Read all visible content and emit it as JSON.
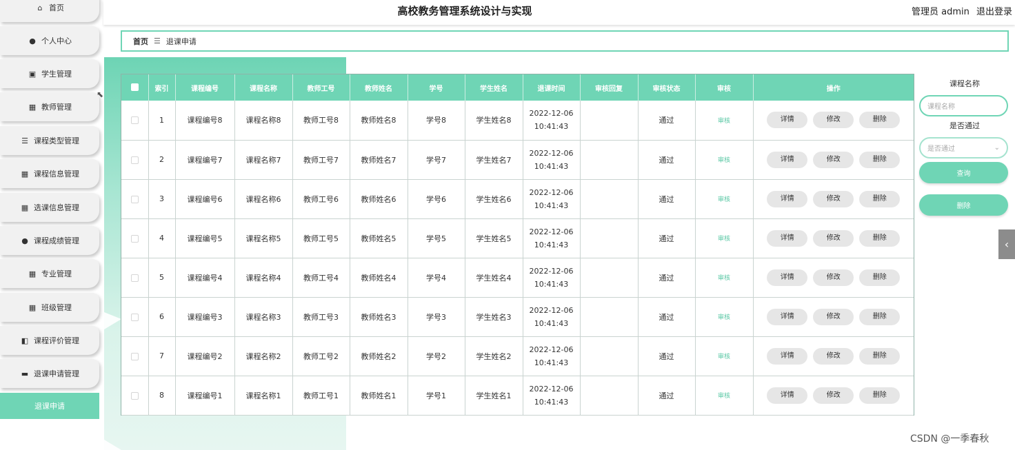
{
  "header": {
    "title": "高校教务管理系统设计与实现",
    "user": "管理员 admin",
    "logout": "退出登录"
  },
  "sidebar": {
    "items": [
      {
        "label": "首页",
        "icon": "home-icon",
        "glyph": "⌂"
      },
      {
        "label": "个人中心",
        "icon": "user-icon",
        "glyph": "●"
      },
      {
        "label": "学生管理",
        "icon": "clipboard-icon",
        "glyph": "▣"
      },
      {
        "label": "教师管理",
        "icon": "grid-icon",
        "glyph": "▦"
      },
      {
        "label": "课程类型管理",
        "icon": "list-icon",
        "glyph": "☰"
      },
      {
        "label": "课程信息管理",
        "icon": "grid-icon",
        "glyph": "▦"
      },
      {
        "label": "选课信息管理",
        "icon": "grid-icon",
        "glyph": "▦"
      },
      {
        "label": "课程成绩管理",
        "icon": "person-icon",
        "glyph": "●"
      },
      {
        "label": "专业管理",
        "icon": "grid-icon",
        "glyph": "▦"
      },
      {
        "label": "班级管理",
        "icon": "grid-icon",
        "glyph": "▦"
      },
      {
        "label": "课程评价管理",
        "icon": "thumb-icon",
        "glyph": "◧"
      },
      {
        "label": "退课申请管理",
        "icon": "briefcase-icon",
        "glyph": "▬"
      }
    ],
    "active": "退课申请"
  },
  "breadcrumb": {
    "home": "首页",
    "separator": "☰",
    "current": "退课申请"
  },
  "table": {
    "headers": [
      "索引",
      "课程编号",
      "课程名称",
      "教师工号",
      "教师姓名",
      "学号",
      "学生姓名",
      "退课时间",
      "审核回复",
      "审核状态",
      "审核",
      "操作"
    ],
    "rows": [
      {
        "index": "1",
        "course_no": "课程编号8",
        "course_name": "课程名称8",
        "teacher_no": "教师工号8",
        "teacher_name": "教师姓名8",
        "student_no": "学号8",
        "student_name": "学生姓名8",
        "date": "2022-12-06",
        "time": "10:41:43",
        "reply": "",
        "status": "通过"
      },
      {
        "index": "2",
        "course_no": "课程编号7",
        "course_name": "课程名称7",
        "teacher_no": "教师工号7",
        "teacher_name": "教师姓名7",
        "student_no": "学号7",
        "student_name": "学生姓名7",
        "date": "2022-12-06",
        "time": "10:41:43",
        "reply": "",
        "status": "通过"
      },
      {
        "index": "3",
        "course_no": "课程编号6",
        "course_name": "课程名称6",
        "teacher_no": "教师工号6",
        "teacher_name": "教师姓名6",
        "student_no": "学号6",
        "student_name": "学生姓名6",
        "date": "2022-12-06",
        "time": "10:41:43",
        "reply": "",
        "status": "通过"
      },
      {
        "index": "4",
        "course_no": "课程编号5",
        "course_name": "课程名称5",
        "teacher_no": "教师工号5",
        "teacher_name": "教师姓名5",
        "student_no": "学号5",
        "student_name": "学生姓名5",
        "date": "2022-12-06",
        "time": "10:41:43",
        "reply": "",
        "status": "通过"
      },
      {
        "index": "5",
        "course_no": "课程编号4",
        "course_name": "课程名称4",
        "teacher_no": "教师工号4",
        "teacher_name": "教师姓名4",
        "student_no": "学号4",
        "student_name": "学生姓名4",
        "date": "2022-12-06",
        "time": "10:41:43",
        "reply": "",
        "status": "通过"
      },
      {
        "index": "6",
        "course_no": "课程编号3",
        "course_name": "课程名称3",
        "teacher_no": "教师工号3",
        "teacher_name": "教师姓名3",
        "student_no": "学号3",
        "student_name": "学生姓名3",
        "date": "2022-12-06",
        "time": "10:41:43",
        "reply": "",
        "status": "通过"
      },
      {
        "index": "7",
        "course_no": "课程编号2",
        "course_name": "课程名称2",
        "teacher_no": "教师工号2",
        "teacher_name": "教师姓名2",
        "student_no": "学号2",
        "student_name": "学生姓名2",
        "date": "2022-12-06",
        "time": "10:41:43",
        "reply": "",
        "status": "通过"
      },
      {
        "index": "8",
        "course_no": "课程编号1",
        "course_name": "课程名称1",
        "teacher_no": "教师工号1",
        "teacher_name": "教师姓名1",
        "student_no": "学号1",
        "student_name": "学生姓名1",
        "date": "2022-12-06",
        "time": "10:41:43",
        "reply": "",
        "status": "通过"
      }
    ],
    "audit_label": "审核",
    "actions": {
      "detail": "详情",
      "edit": "修改",
      "delete": "删除"
    }
  },
  "search": {
    "course_label": "课程名称",
    "course_placeholder": "课程名称",
    "pass_label": "是否通过",
    "pass_placeholder": "是否通过",
    "query_button": "查询",
    "delete_button": "删除"
  },
  "watermark": "CSDN @一季春秋",
  "colors": {
    "accent": "#6fd5b5",
    "accent_text": "#5cc8a6",
    "button_grey": "#e6e6e6"
  }
}
